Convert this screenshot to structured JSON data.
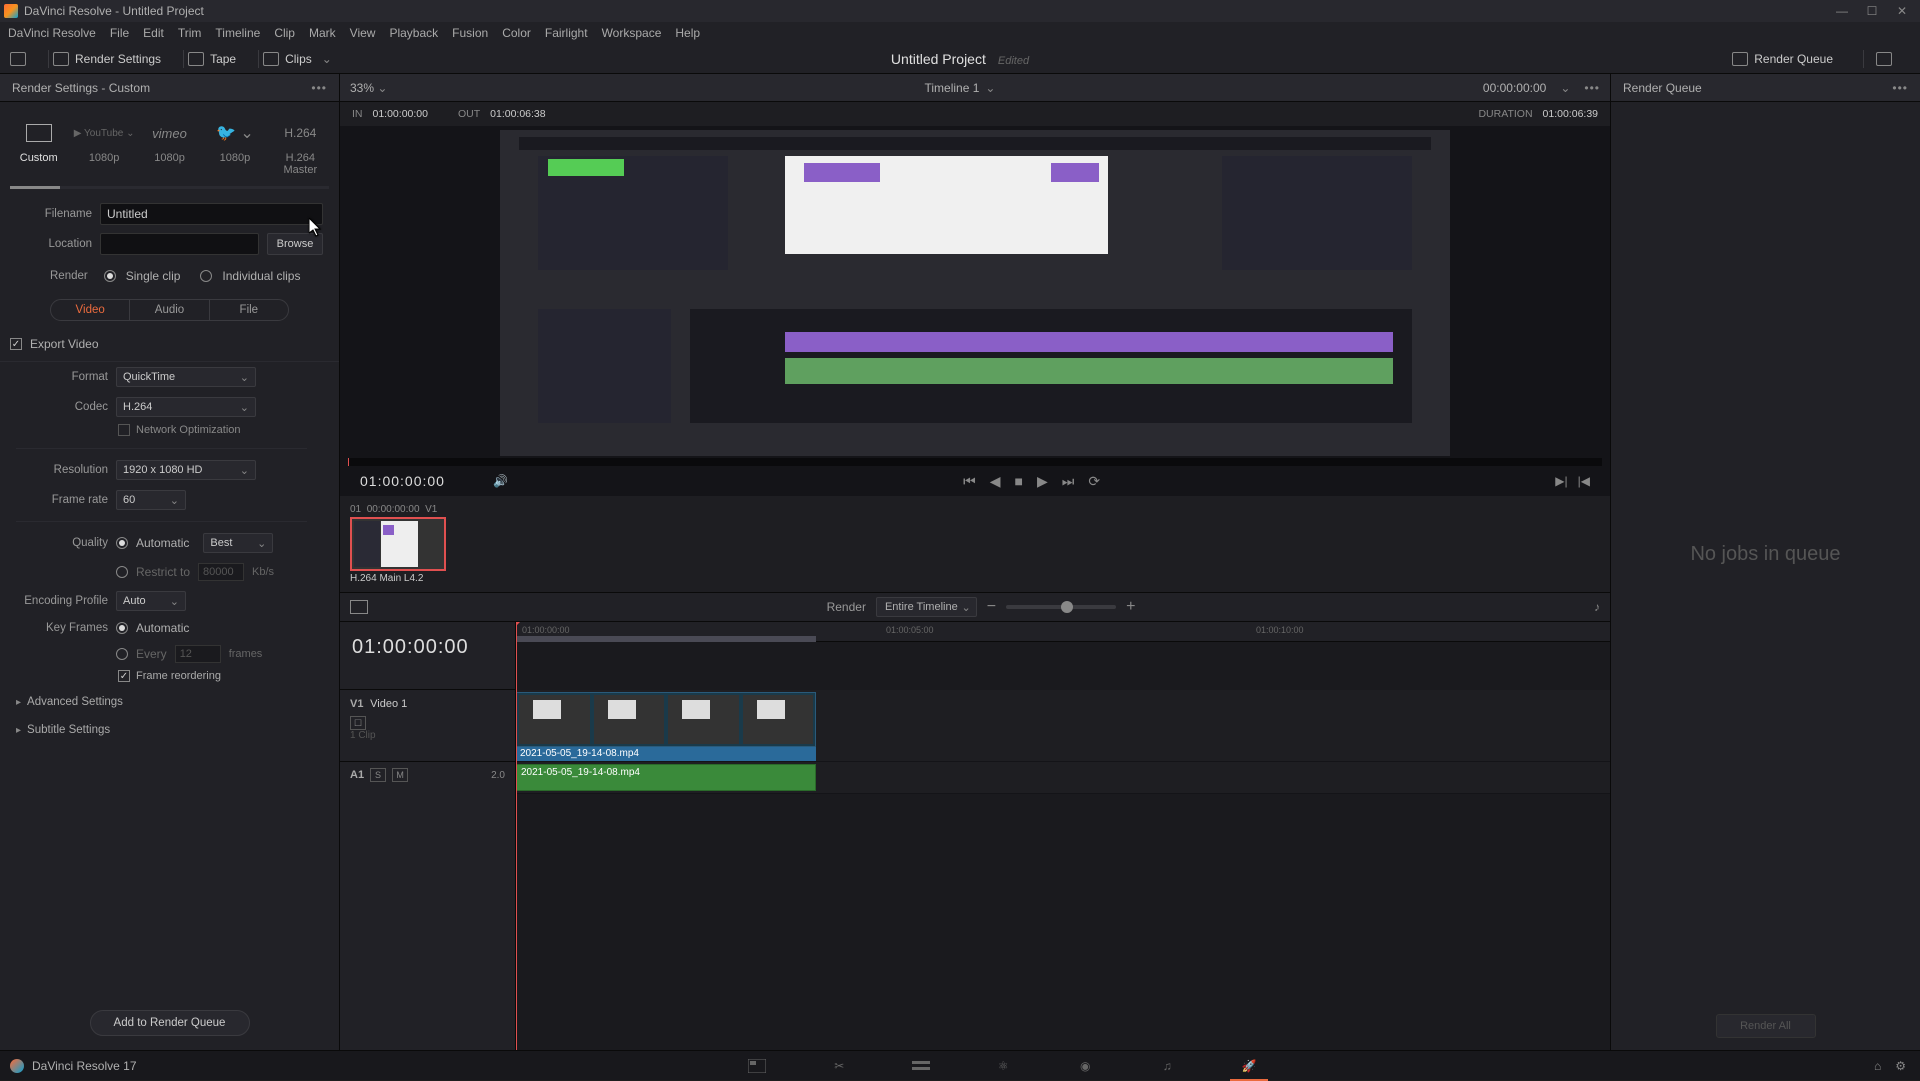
{
  "app": {
    "title": "DaVinci Resolve - Untitled Project"
  },
  "menu": [
    "DaVinci Resolve",
    "File",
    "Edit",
    "Trim",
    "Timeline",
    "Clip",
    "Mark",
    "View",
    "Playback",
    "Fusion",
    "Color",
    "Fairlight",
    "Workspace",
    "Help"
  ],
  "toolbar": {
    "render_settings": "Render Settings",
    "tape": "Tape",
    "clips": "Clips",
    "project": "Untitled Project",
    "edited": "Edited",
    "render_queue": "Render Queue"
  },
  "left": {
    "header": "Render Settings - Custom",
    "presets": [
      {
        "label": "Custom"
      },
      {
        "label": "1080p",
        "sub": "YouTube"
      },
      {
        "label": "1080p",
        "sub": "vimeo"
      },
      {
        "label": "1080p",
        "sub": "Twitter"
      },
      {
        "label": "H.264 Master",
        "sub": "H.264"
      }
    ],
    "filename_label": "Filename",
    "filename_value": "Untitled",
    "location_label": "Location",
    "location_value": "",
    "browse": "Browse",
    "render_label": "Render",
    "single": "Single clip",
    "individual": "Individual clips",
    "tabs": {
      "video": "Video",
      "audio": "Audio",
      "file": "File"
    },
    "export_video": "Export Video",
    "format_label": "Format",
    "format_value": "QuickTime",
    "codec_label": "Codec",
    "codec_value": "H.264",
    "netopt": "Network Optimization",
    "resolution_label": "Resolution",
    "resolution_value": "1920 x 1080 HD",
    "framerate_label": "Frame rate",
    "framerate_value": "60",
    "quality_label": "Quality",
    "quality_auto": "Automatic",
    "quality_best": "Best",
    "restrict": "Restrict to",
    "restrict_val": "80000",
    "restrict_unit": "Kb/s",
    "encprof_label": "Encoding Profile",
    "encprof_value": "Auto",
    "keyframes_label": "Key Frames",
    "keyframes_auto": "Automatic",
    "every": "Every",
    "every_val": "12",
    "every_unit": "frames",
    "reorder": "Frame reordering",
    "advanced": "Advanced Settings",
    "subtitle": "Subtitle Settings",
    "add_queue": "Add to Render Queue"
  },
  "viewer": {
    "zoom": "33%",
    "timeline_name": "Timeline 1",
    "tc": "00:00:00:00",
    "in_label": "IN",
    "in_tc": "01:00:00:00",
    "out_label": "OUT",
    "out_tc": "01:00:06:38",
    "dur_label": "DURATION",
    "dur_tc": "01:00:06:39",
    "play_tc": "01:00:00:00",
    "clip_meta_idx": "01",
    "clip_meta_tc": "00:00:00:00",
    "clip_meta_trk": "V1",
    "clip_name": "H.264 Main L4.2"
  },
  "tltools": {
    "render_label": "Render",
    "render_scope": "Entire Timeline"
  },
  "timeline": {
    "bigtc": "01:00:00:00",
    "v1_name": "V1",
    "v1_label": "Video 1",
    "v1_sub": "1 Clip",
    "a1_name": "A1",
    "a1_s": "S",
    "a1_m": "M",
    "a1_ch": "2.0",
    "clip_filename": "2021-05-05_19-14-08.mp4",
    "ticks": [
      "01:00:00:00",
      "01:00:05:00",
      "01:00:10:00"
    ]
  },
  "rqueue": {
    "header": "Render Queue",
    "empty": "No jobs in queue",
    "render_all": "Render All"
  },
  "footer": {
    "app": "DaVinci Resolve 17"
  }
}
